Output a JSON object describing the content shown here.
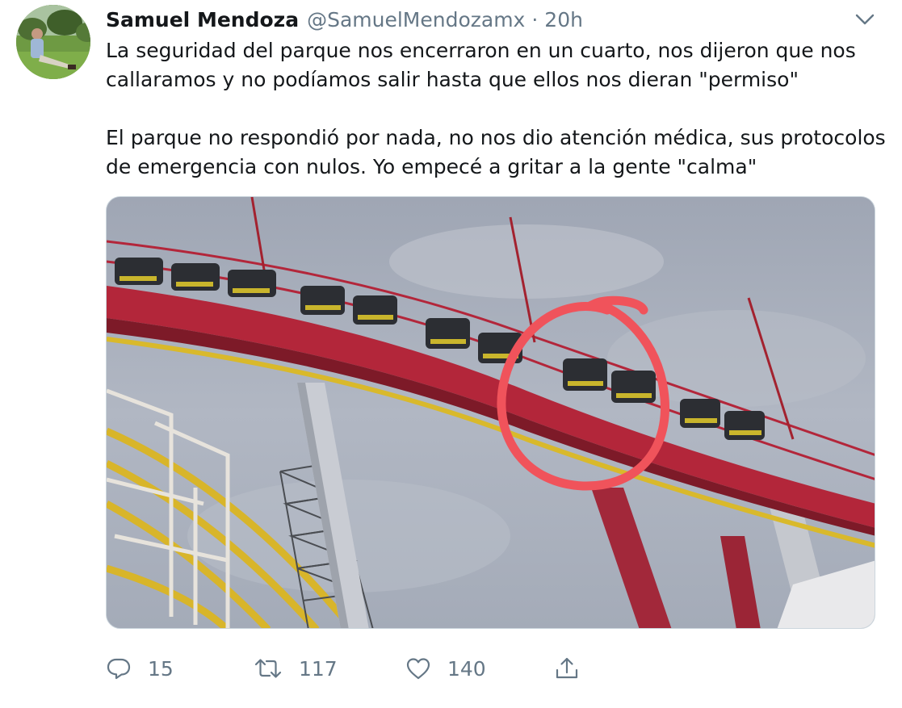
{
  "tweet": {
    "author_name": "Samuel Mendoza",
    "handle": "@SamuelMendozamx",
    "separator": "·",
    "time": "20h",
    "paragraphs": [
      "La seguridad del parque nos encerraron en un cuarto, nos dijeron que nos callaramos y no podíamos salir hasta que ellos nos dieran \"permiso\"",
      "El parque no respondió por nada, no nos dio atención médica, sus protocolos de emergencia con nulos. Yo empecé a gritar a la gente \"calma\""
    ]
  },
  "actions": {
    "replies": "15",
    "retweets": "117",
    "likes": "140"
  },
  "icons": {
    "more": "chevron-down-icon",
    "reply": "reply-icon",
    "retweet": "retweet-icon",
    "like": "heart-icon",
    "share": "share-icon"
  },
  "colors": {
    "text": "#14171a",
    "secondary": "#657786",
    "border": "#ccd6dd",
    "coaster_track": "#b3263a",
    "support_track": "#e3c12a",
    "highlight_circle": "#f0535b"
  }
}
